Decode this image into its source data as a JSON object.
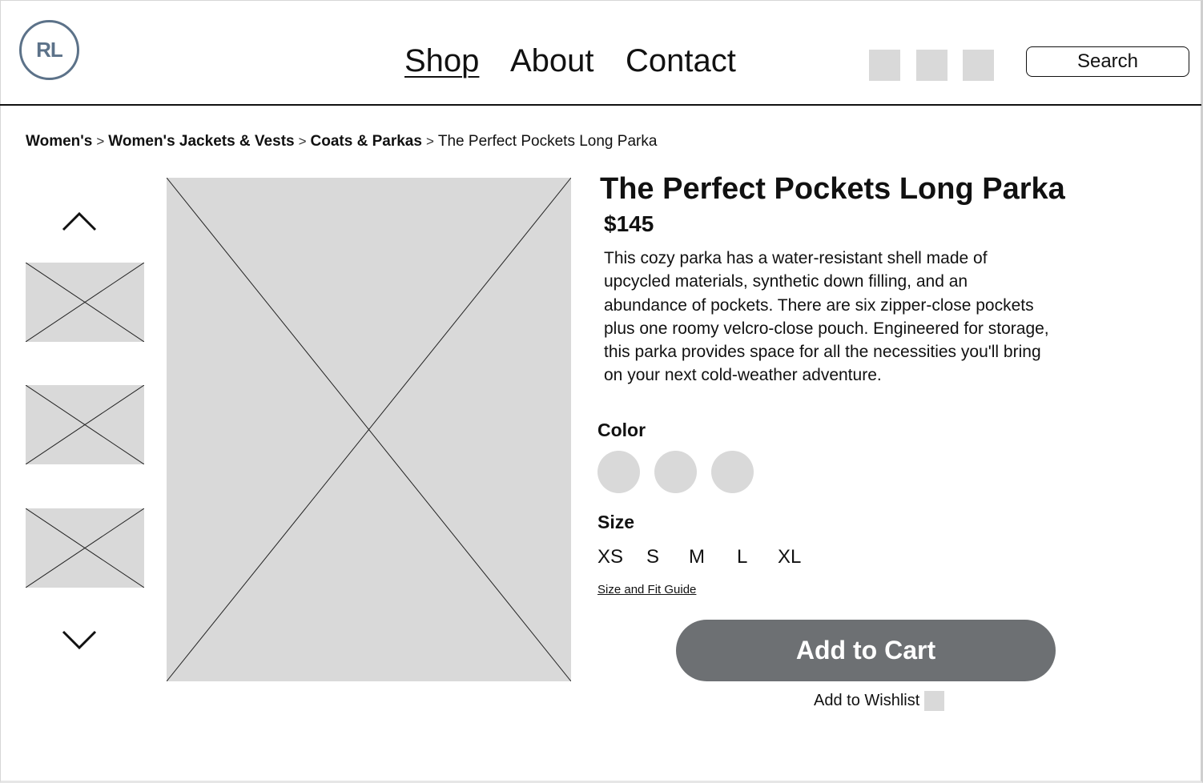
{
  "header": {
    "logo_text": "RL",
    "nav": [
      {
        "label": "Shop",
        "active": true
      },
      {
        "label": "About",
        "active": false
      },
      {
        "label": "Contact",
        "active": false
      }
    ],
    "icons": [
      "placeholder-icon",
      "placeholder-icon",
      "placeholder-icon"
    ],
    "search_label": "Search"
  },
  "breadcrumb": {
    "items": [
      "Women's",
      "Women's Jackets & Vests",
      "Coats & Parkas",
      "The Perfect Pockets Long Parka"
    ],
    "separator": ">"
  },
  "gallery": {
    "up_icon": "chevron-up-icon",
    "down_icon": "chevron-down-icon",
    "thumbnail_count": 3
  },
  "product": {
    "title": "The Perfect Pockets Long Parka",
    "price": "$145",
    "description": "This cozy parka has a water-resistant shell made of upcycled materials, synthetic down filling, and an abundance of pockets. There are six zipper-close pockets plus one roomy velcro-close pouch. Engineered for storage, this parka provides space for all the necessities you'll bring on your next cold-weather adventure.",
    "color_label": "Color",
    "colors": [
      "#d9d9d9",
      "#d9d9d9",
      "#d9d9d9"
    ],
    "size_label": "Size",
    "sizes": [
      "XS",
      "S",
      "M",
      "L",
      "XL"
    ],
    "fit_guide": "Size and Fit Guide",
    "cart_button": "Add to Cart",
    "wishlist_label": "Add to Wishlist"
  },
  "colors": {
    "logo": "#5c7289",
    "placeholder": "#d9d9d9",
    "cart_button": "#6d7073"
  }
}
